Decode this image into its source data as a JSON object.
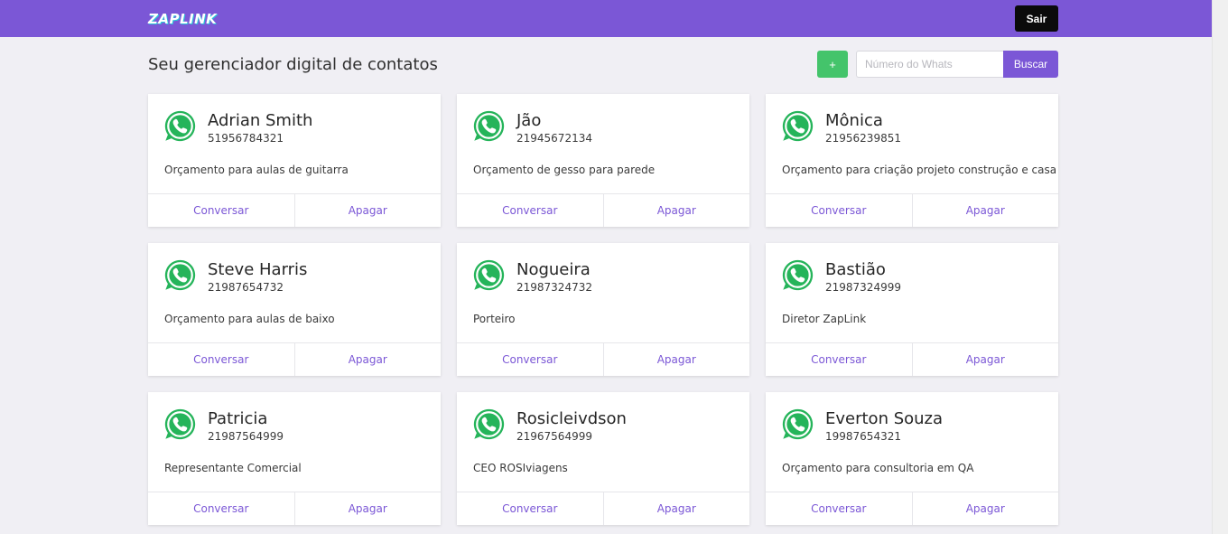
{
  "header": {
    "logo_text": "ZAPLINK",
    "logout_label": "Sair",
    "accent_color": "#7b57d6"
  },
  "toolbar": {
    "title": "Seu gerenciador digital de contatos",
    "add_label": "+",
    "search_placeholder": "Número do Whats",
    "search_label": "Buscar"
  },
  "contacts": [
    {
      "name": "Adrian Smith",
      "phone": "51956784321",
      "description": "Orçamento para aulas de guitarra",
      "chat_label": "Conversar",
      "delete_label": "Apagar",
      "icon": "whatsapp-icon"
    },
    {
      "name": "Jão",
      "phone": "21945672134",
      "description": "Orçamento de gesso para parede",
      "chat_label": "Conversar",
      "delete_label": "Apagar",
      "icon": "whatsapp-icon"
    },
    {
      "name": "Mônica",
      "phone": "21956239851",
      "description": "Orçamento para criação projeto construção e casa",
      "chat_label": "Conversar",
      "delete_label": "Apagar",
      "icon": "whatsapp-icon"
    },
    {
      "name": "Steve Harris",
      "phone": "21987654732",
      "description": "Orçamento para aulas de baixo",
      "chat_label": "Conversar",
      "delete_label": "Apagar",
      "icon": "whatsapp-icon"
    },
    {
      "name": "Nogueira",
      "phone": "21987324732",
      "description": "Porteiro",
      "chat_label": "Conversar",
      "delete_label": "Apagar",
      "icon": "whatsapp-icon"
    },
    {
      "name": "Bastião",
      "phone": "21987324999",
      "description": "Diretor ZapLink",
      "chat_label": "Conversar",
      "delete_label": "Apagar",
      "icon": "whatsapp-icon"
    },
    {
      "name": "Patricia",
      "phone": "21987564999",
      "description": "Representante Comercial",
      "chat_label": "Conversar",
      "delete_label": "Apagar",
      "icon": "whatsapp-icon"
    },
    {
      "name": "Rosicleivdson",
      "phone": "21967564999",
      "description": "CEO ROSIviagens",
      "chat_label": "Conversar",
      "delete_label": "Apagar",
      "icon": "whatsapp-icon"
    },
    {
      "name": "Everton Souza",
      "phone": "19987654321",
      "description": "Orçamento para consultoria em QA",
      "chat_label": "Conversar",
      "delete_label": "Apagar",
      "icon": "whatsapp-icon"
    }
  ]
}
